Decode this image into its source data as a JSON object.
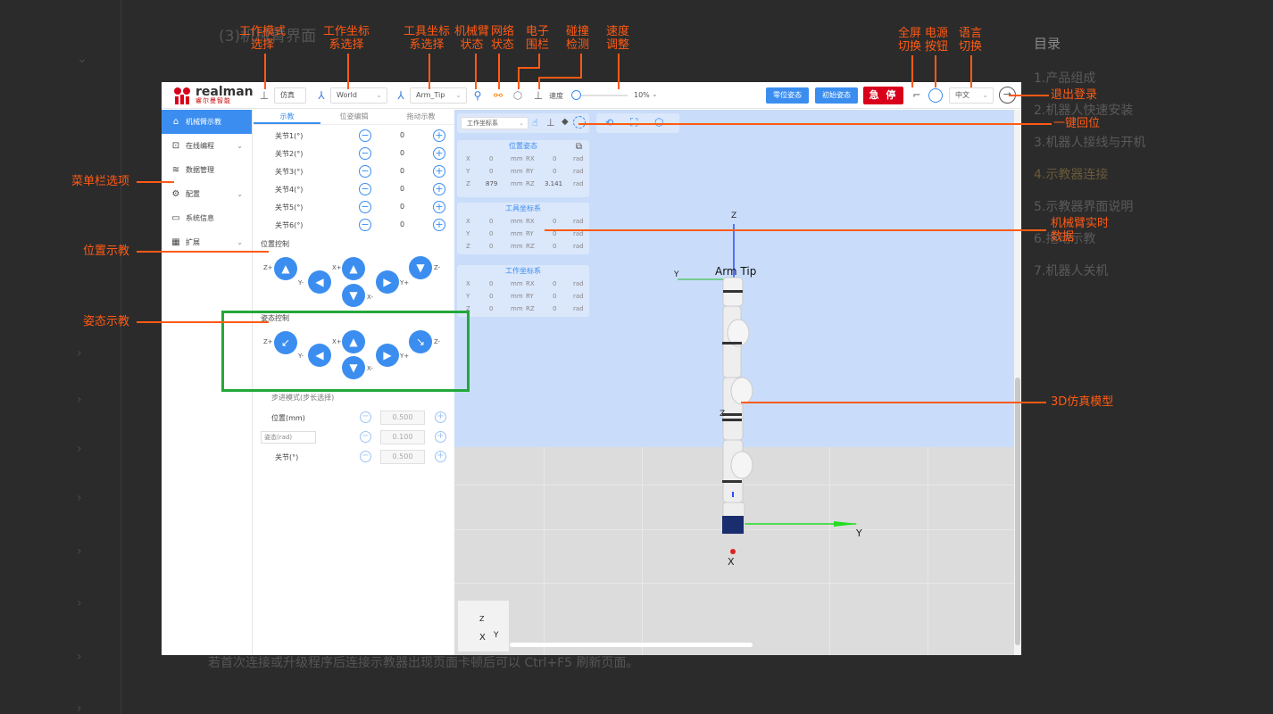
{
  "doc": {
    "heading": "(3)机械臂界面",
    "footer_note": "若首次连接或升级程序后连接示教器出现页面卡顿后可以 Ctrl+F5  刷新页面。",
    "toc_title": "目录",
    "toc_items": [
      "1.产品组成",
      "2.机器人快速安装",
      "3.机器人接线与开机",
      "4.示教器连接",
      "5.示教器界面说明",
      "6.拖动示教",
      "7.机器人关机"
    ]
  },
  "annotations": {
    "work_mode": "工作模式\n选择",
    "work_coord": "工作坐标\n系选择",
    "tool_coord": "工具坐标\n系选择",
    "arm_status": "机械臂\n状态",
    "net_status": "网络\n状态",
    "fence": "电子\n围栏",
    "collision": "碰撞\n检测",
    "speed": "速度\n调整",
    "fullscreen": "全屏\n切换",
    "power": "电源\n按钮",
    "language": "语言\n切换",
    "logout": "退出登录",
    "home": "一键回位",
    "menu": "菜单栏选项",
    "pos_teach": "位置示教",
    "pose_teach": "姿态示教",
    "realtime": "机械臂实时\n数据",
    "model3d": "3D仿真模型"
  },
  "app": {
    "logo_en": "realman",
    "logo_cn": "睿尔曼智能",
    "mode_label": "仿真",
    "work_frame": "World",
    "tool_frame": "Arm_Tip",
    "speed_label": "速度",
    "speed_value": "10%",
    "zero_pose_btn": "零位姿态",
    "init_pose_btn": "初始姿态",
    "estop_btn": "急 停",
    "language_value": "中文",
    "sidebar": [
      {
        "label": "机械臂示教",
        "icon": "home-icon",
        "active": true
      },
      {
        "label": "在线编程",
        "icon": "code-icon",
        "expand": true
      },
      {
        "label": "数据管理",
        "icon": "database-icon"
      },
      {
        "label": "配置",
        "icon": "config-icon",
        "expand": true
      },
      {
        "label": "系统信息",
        "icon": "monitor-icon"
      },
      {
        "label": "扩展",
        "icon": "grid-icon",
        "expand": true
      }
    ],
    "tabs": [
      "示教",
      "位姿编辑",
      "拖动示教"
    ],
    "joints": [
      {
        "label": "关节1(°)",
        "value": "0"
      },
      {
        "label": "关节2(°)",
        "value": "0"
      },
      {
        "label": "关节3(°)",
        "value": "0"
      },
      {
        "label": "关节4(°)",
        "value": "0"
      },
      {
        "label": "关节5(°)",
        "value": "0"
      },
      {
        "label": "关节6(°)",
        "value": "0"
      }
    ],
    "position_control": "位置控制",
    "pose_control": "姿态控制",
    "jog_labels": {
      "zp": "Z+",
      "zm": "Z-",
      "xp": "X+",
      "xm": "X-",
      "yp": "Y+",
      "ym": "Y-"
    },
    "step_mode": "步进模式(步长选择)",
    "step_rows": [
      {
        "label": "位置(mm)",
        "value": "0.500"
      },
      {
        "label": "姿态(rad)",
        "value": "0.100"
      },
      {
        "label": "关节(°)",
        "value": "0.500"
      }
    ],
    "scene_frame": "工作坐标系",
    "cards": [
      {
        "title": "位置姿态",
        "rows": [
          [
            "X",
            "0",
            "mm",
            "RX",
            "0",
            "rad"
          ],
          [
            "Y",
            "0",
            "mm",
            "RY",
            "0",
            "rad"
          ],
          [
            "Z",
            "879",
            "mm",
            "RZ",
            "3.141",
            "rad"
          ]
        ]
      },
      {
        "title": "工具坐标系",
        "rows": [
          [
            "X",
            "0",
            "mm",
            "RX",
            "0",
            "rad"
          ],
          [
            "Y",
            "0",
            "mm",
            "RY",
            "0",
            "rad"
          ],
          [
            "Z",
            "0",
            "mm",
            "RZ",
            "0",
            "rad"
          ]
        ]
      },
      {
        "title": "工作坐标系",
        "rows": [
          [
            "X",
            "0",
            "mm",
            "RX",
            "0",
            "rad"
          ],
          [
            "Y",
            "0",
            "mm",
            "RY",
            "0",
            "rad"
          ],
          [
            "Z",
            "0",
            "mm",
            "RZ",
            "0",
            "rad"
          ]
        ]
      }
    ],
    "arm_tip_label": "Arm Tip",
    "axis_z": "Z",
    "axis_y": "Y",
    "axis_x": "X"
  }
}
